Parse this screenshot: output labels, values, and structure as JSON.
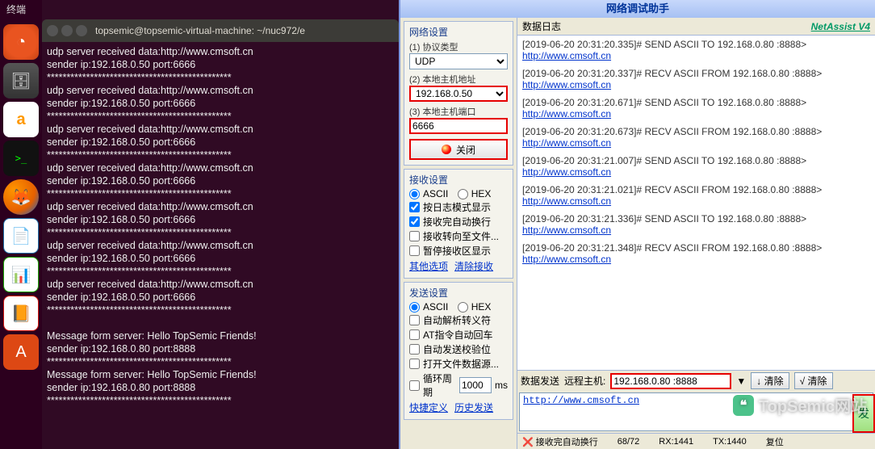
{
  "topbar": "终端",
  "terminal": {
    "title": "topsemic@topsemic-virtual-machine: ~/nuc972/e",
    "block": {
      "recv": "udp server received data:http://www.cmsoft.cn",
      "sender": "sender ip:192.168.0.50 port:6666",
      "sep": "***********************************************"
    },
    "msg": {
      "line": "Message form server: Hello TopSemic Friends!",
      "sender": "sender ip:192.168.0.80 port:8888",
      "sep": "***********************************************"
    }
  },
  "netassist": {
    "title": "网络调试助手",
    "brand": "NetAssist V4",
    "groups": {
      "net": "网络设置",
      "proto_lbl": "(1) 协议类型",
      "proto_val": "UDP",
      "host_lbl": "(2) 本地主机地址",
      "host_val": "192.168.0.50",
      "port_lbl": "(3) 本地主机端口",
      "port_val": "6666",
      "close_btn": "关闭",
      "recv": "接收设置",
      "ascii": "ASCII",
      "hex": "HEX",
      "r1": "按日志模式显示",
      "r2": "接收完自动换行",
      "r3": "接收转向至文件...",
      "r4": "暂停接收区显示",
      "other": "其他选项",
      "clear": "清除接收",
      "send": "发送设置",
      "s1": "自动解析转义符",
      "s2": "AT指令自动回车",
      "s3": "自动发送校验位",
      "s4": "打开文件数据源...",
      "cycle_lbl": "循环周期",
      "cycle_val": "1000",
      "cycle_unit": "ms",
      "quick": "快捷定义",
      "hist": "历史发送"
    },
    "log": {
      "title": "数据日志",
      "entries": [
        {
          "t": "[2019-06-20 20:31:20.335]# SEND ASCII TO 192.168.0.80 :8888>",
          "u": "http://www.cmsoft.cn"
        },
        {
          "t": "[2019-06-20 20:31:20.337]# RECV ASCII FROM 192.168.0.80 :8888>",
          "u": "http://www.cmsoft.cn"
        },
        {
          "t": "[2019-06-20 20:31:20.671]# SEND ASCII TO 192.168.0.80 :8888>",
          "u": "http://www.cmsoft.cn"
        },
        {
          "t": "[2019-06-20 20:31:20.673]# RECV ASCII FROM 192.168.0.80 :8888>",
          "u": "http://www.cmsoft.cn"
        },
        {
          "t": "[2019-06-20 20:31:21.007]# SEND ASCII TO 192.168.0.80 :8888>",
          "u": "http://www.cmsoft.cn"
        },
        {
          "t": "[2019-06-20 20:31:21.021]# RECV ASCII FROM 192.168.0.80 :8888>",
          "u": "http://www.cmsoft.cn"
        },
        {
          "t": "[2019-06-20 20:31:21.336]# SEND ASCII TO 192.168.0.80 :8888>",
          "u": "http://www.cmsoft.cn"
        },
        {
          "t": "[2019-06-20 20:31:21.348]# RECV ASCII FROM 192.168.0.80 :8888>",
          "u": "http://www.cmsoft.cn"
        }
      ]
    },
    "sendbar": {
      "title": "数据发送",
      "remote_lbl": "远程主机:",
      "remote_val": "192.168.0.80 :8888",
      "clearbtn": "清除",
      "clearbtn2": "清除",
      "sendtext": "http://www.cmsoft.cn",
      "sendbtn": "发"
    },
    "status": {
      "auto": "接收完自动换行",
      "count": "68/72",
      "rx": "RX:1441",
      "tx": "TX:1440",
      "reset": "复位"
    },
    "watermark": "TopSemic网站"
  }
}
